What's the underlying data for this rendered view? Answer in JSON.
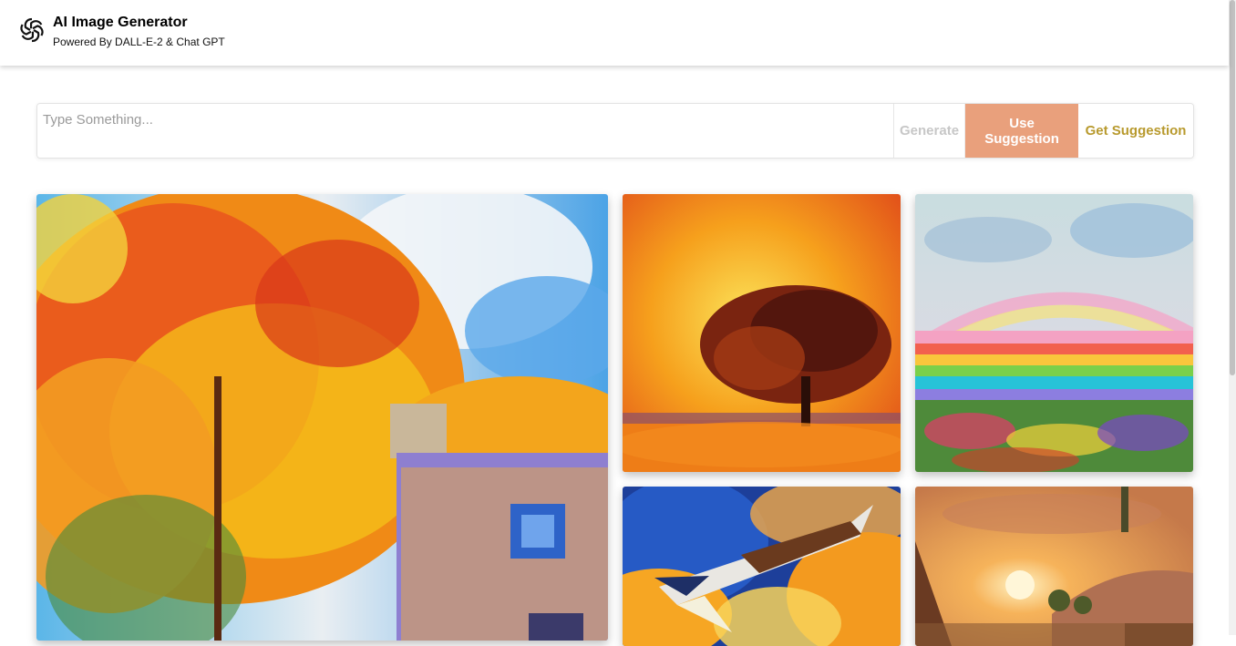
{
  "header": {
    "title": "AI Image Generator",
    "subtitle": "Powered By DALL-E-2 & Chat GPT",
    "logo_icon": "openai-logo-icon"
  },
  "prompt": {
    "placeholder": "Type Something...",
    "value": ""
  },
  "buttons": {
    "generate": "Generate",
    "use_suggestion": "Use Suggestion",
    "get_suggestion": "Get Suggestion"
  },
  "colors": {
    "use_suggestion_bg": "#e9a07c",
    "get_suggestion_text": "#b89a2e",
    "generate_text": "#c7c7c7"
  },
  "gallery": [
    {
      "subject": "autumn tree and house painting"
    },
    {
      "subject": "sunset tree painting"
    },
    {
      "subject": "rainbow over flower field painting"
    },
    {
      "subject": "space shuttle launch painting"
    },
    {
      "subject": "sunset village landscape painting"
    }
  ]
}
